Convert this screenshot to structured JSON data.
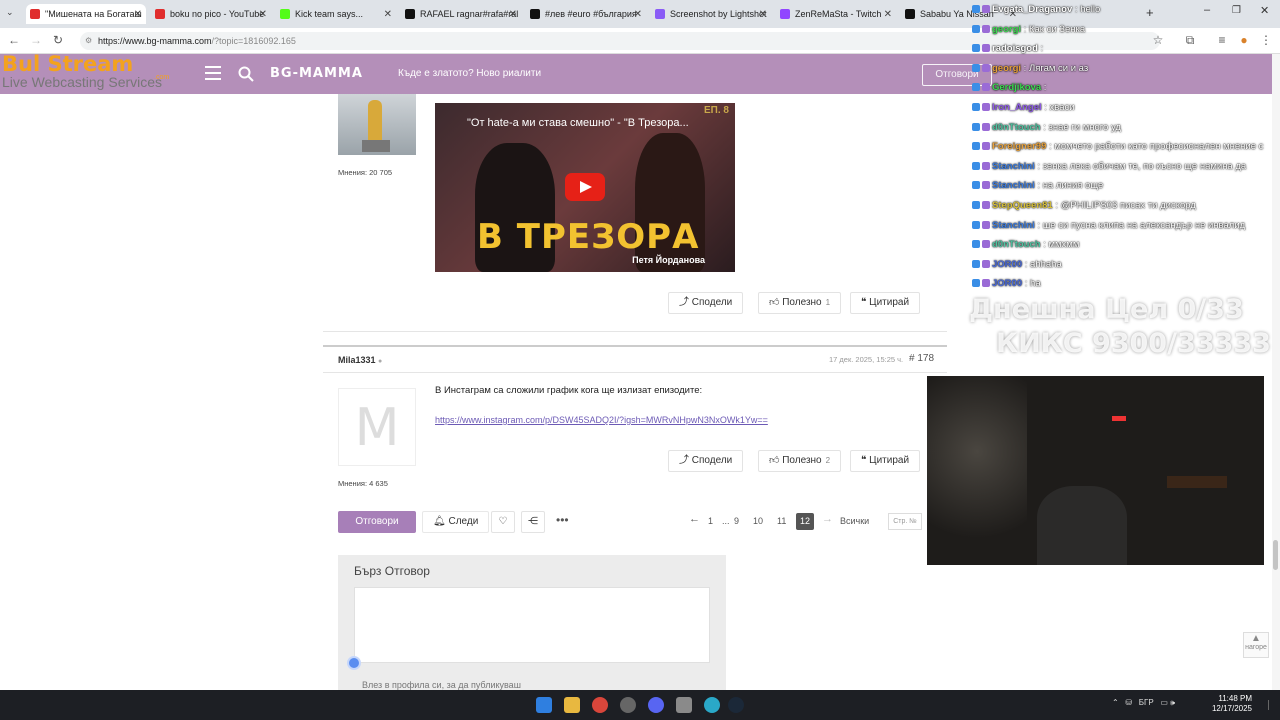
{
  "browser": {
    "tabs": [
      {
        "label": "\"Мишената на Богаташ",
        "color": "#e02d2d"
      },
      {
        "label": "boku no pico - YouTube",
        "color": "#e02d2d"
      },
      {
        "label": "Kick team says...",
        "color": "#53fc18"
      },
      {
        "label": "RAFAEL ragnar#rafa#ral",
        "color": "#111111"
      },
      {
        "label": "#лев #euro #българия",
        "color": "#111111"
      },
      {
        "label": "Screenshot by Lightshot",
        "color": "#8a5cf6"
      },
      {
        "label": "ZenReMaSta - Twitch",
        "color": "#9146ff"
      },
      {
        "label": "Sababu Ya Nissan",
        "color": "#111111"
      }
    ],
    "url_host": "https://www.bg-mamma.com",
    "url_path": "/?topic=1816092.165"
  },
  "overlay": {
    "bulstream_title": "Bul Stream",
    "bulstream_com": ".com",
    "bulstream_sub": "Live Webcasting Services"
  },
  "site": {
    "logo": "BG-MAMMA",
    "headline": "Къде е златото? Ново риалити",
    "reply_label": "Отговори"
  },
  "post1": {
    "posts_count": "Мнения: 20 705",
    "video": {
      "title": "\"От hate-а ми става смешно\" - \"В Трезора...",
      "episode": "ЕП. 8",
      "big_text": "В ТРЕЗОРА",
      "subtitle": "Петя Йорданова"
    },
    "share": "Сподели",
    "useful": "Полезно",
    "useful_count": "1",
    "quote": "Цитирай"
  },
  "post2": {
    "author": "Mila1331",
    "date": "17 дек. 2025, 15:25 ч.",
    "number": "# 178",
    "avatar_letter": "M",
    "body": "В Инстаграм са сложили график кога ще излизат епизодите:",
    "link": "https://www.instagram.com/p/DSW45SADQ2I/?igsh=MWRvNHpwN3NxOWk1Yw==",
    "posts_count": "Мнения: 4 635",
    "share": "Сподели",
    "useful": "Полезно",
    "useful_count": "2",
    "quote": "Цитирай"
  },
  "footer_actions": {
    "reply": "Отговори",
    "follow": "Следи"
  },
  "pagination": {
    "pages": [
      "1",
      "...",
      "9",
      "10",
      "11"
    ],
    "current": "12",
    "all": "Всички",
    "page_input_placeholder": "Стр. №"
  },
  "quick_reply": {
    "title": "Бърз Отговор",
    "login_prompt": "Влез в профила си, за да публикуваш"
  },
  "scroll_top": "нагоре",
  "chat": [
    {
      "user": "Evgata_Draganov",
      "msg": "hello",
      "color": "#ffffff"
    },
    {
      "user": "georgi",
      "msg": "Как си Зенка",
      "color": "#3ddc52"
    },
    {
      "user": "radoisgod",
      "msg": "",
      "color": "#ffffff"
    },
    {
      "user": "georgi",
      "msg": "Лягам си и аз",
      "color": "#e8a23d"
    },
    {
      "user": "Gerdjikova",
      "msg": "",
      "color": "#3ddc52"
    },
    {
      "user": "Iron_Angel",
      "msg": "хваси",
      "color": "#8f5be8"
    },
    {
      "user": "d0nTtouch",
      "msg": "знае ги много уд",
      "color": "#4fc3a1"
    },
    {
      "user": "Foreigner99",
      "msg": "момчето работи като професионален мнение с",
      "color": "#e8a23d"
    },
    {
      "user": "Stanchini",
      "msg": "зенка лека обичам те, по късно ще намина да",
      "color": "#3b7bdd"
    },
    {
      "user": "Stanchini",
      "msg": "на линия още",
      "color": "#3b7bdd"
    },
    {
      "user": "StepQueen81",
      "msg": "@PHILIPS03 писах ти дискорд",
      "color": "#d9c23a"
    },
    {
      "user": "Stanchini",
      "msg": "ше си пусна клипа на александър не инвалид",
      "color": "#3b7bdd"
    },
    {
      "user": "d0nTtouch",
      "msg": "ммхмм",
      "color": "#4fc3a1"
    },
    {
      "user": "JOR00",
      "msg": "ahhaha",
      "color": "#4a6bdb"
    },
    {
      "user": "JOR00",
      "msg": "ha",
      "color": "#4a6bdb"
    }
  ],
  "goal": {
    "line1": "Днешна Цел 0/33",
    "line2": "КИКС 9300/33333"
  },
  "taskbar": {
    "lang": "БГР",
    "time": "11:48 PM",
    "date": "12/17/2025"
  }
}
